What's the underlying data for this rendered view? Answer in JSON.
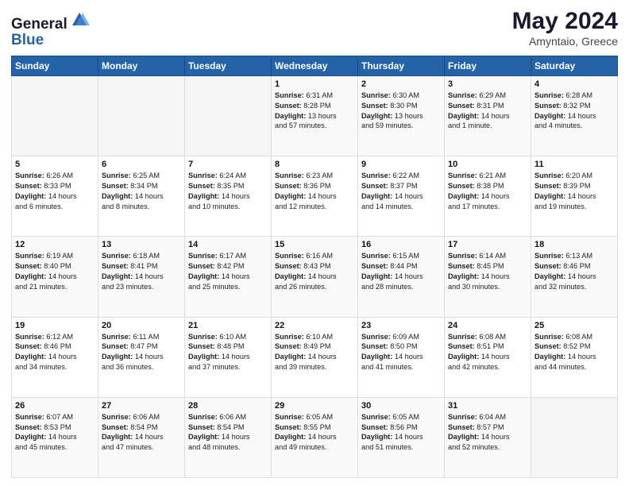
{
  "header": {
    "logo_line1": "General",
    "logo_line2": "Blue",
    "month_year": "May 2024",
    "location": "Amyntaio, Greece"
  },
  "days_of_week": [
    "Sunday",
    "Monday",
    "Tuesday",
    "Wednesday",
    "Thursday",
    "Friday",
    "Saturday"
  ],
  "weeks": [
    [
      {
        "day": "",
        "info": ""
      },
      {
        "day": "",
        "info": ""
      },
      {
        "day": "",
        "info": ""
      },
      {
        "day": "1",
        "info": "Sunrise: 6:31 AM\nSunset: 8:28 PM\nDaylight: 13 hours\nand 57 minutes."
      },
      {
        "day": "2",
        "info": "Sunrise: 6:30 AM\nSunset: 8:30 PM\nDaylight: 13 hours\nand 59 minutes."
      },
      {
        "day": "3",
        "info": "Sunrise: 6:29 AM\nSunset: 8:31 PM\nDaylight: 14 hours\nand 1 minute."
      },
      {
        "day": "4",
        "info": "Sunrise: 6:28 AM\nSunset: 8:32 PM\nDaylight: 14 hours\nand 4 minutes."
      }
    ],
    [
      {
        "day": "5",
        "info": "Sunrise: 6:26 AM\nSunset: 8:33 PM\nDaylight: 14 hours\nand 6 minutes."
      },
      {
        "day": "6",
        "info": "Sunrise: 6:25 AM\nSunset: 8:34 PM\nDaylight: 14 hours\nand 8 minutes."
      },
      {
        "day": "7",
        "info": "Sunrise: 6:24 AM\nSunset: 8:35 PM\nDaylight: 14 hours\nand 10 minutes."
      },
      {
        "day": "8",
        "info": "Sunrise: 6:23 AM\nSunset: 8:36 PM\nDaylight: 14 hours\nand 12 minutes."
      },
      {
        "day": "9",
        "info": "Sunrise: 6:22 AM\nSunset: 8:37 PM\nDaylight: 14 hours\nand 14 minutes."
      },
      {
        "day": "10",
        "info": "Sunrise: 6:21 AM\nSunset: 8:38 PM\nDaylight: 14 hours\nand 17 minutes."
      },
      {
        "day": "11",
        "info": "Sunrise: 6:20 AM\nSunset: 8:39 PM\nDaylight: 14 hours\nand 19 minutes."
      }
    ],
    [
      {
        "day": "12",
        "info": "Sunrise: 6:19 AM\nSunset: 8:40 PM\nDaylight: 14 hours\nand 21 minutes."
      },
      {
        "day": "13",
        "info": "Sunrise: 6:18 AM\nSunset: 8:41 PM\nDaylight: 14 hours\nand 23 minutes."
      },
      {
        "day": "14",
        "info": "Sunrise: 6:17 AM\nSunset: 8:42 PM\nDaylight: 14 hours\nand 25 minutes."
      },
      {
        "day": "15",
        "info": "Sunrise: 6:16 AM\nSunset: 8:43 PM\nDaylight: 14 hours\nand 26 minutes."
      },
      {
        "day": "16",
        "info": "Sunrise: 6:15 AM\nSunset: 8:44 PM\nDaylight: 14 hours\nand 28 minutes."
      },
      {
        "day": "17",
        "info": "Sunrise: 6:14 AM\nSunset: 8:45 PM\nDaylight: 14 hours\nand 30 minutes."
      },
      {
        "day": "18",
        "info": "Sunrise: 6:13 AM\nSunset: 8:46 PM\nDaylight: 14 hours\nand 32 minutes."
      }
    ],
    [
      {
        "day": "19",
        "info": "Sunrise: 6:12 AM\nSunset: 8:46 PM\nDaylight: 14 hours\nand 34 minutes."
      },
      {
        "day": "20",
        "info": "Sunrise: 6:11 AM\nSunset: 8:47 PM\nDaylight: 14 hours\nand 36 minutes."
      },
      {
        "day": "21",
        "info": "Sunrise: 6:10 AM\nSunset: 8:48 PM\nDaylight: 14 hours\nand 37 minutes."
      },
      {
        "day": "22",
        "info": "Sunrise: 6:10 AM\nSunset: 8:49 PM\nDaylight: 14 hours\nand 39 minutes."
      },
      {
        "day": "23",
        "info": "Sunrise: 6:09 AM\nSunset: 8:50 PM\nDaylight: 14 hours\nand 41 minutes."
      },
      {
        "day": "24",
        "info": "Sunrise: 6:08 AM\nSunset: 8:51 PM\nDaylight: 14 hours\nand 42 minutes."
      },
      {
        "day": "25",
        "info": "Sunrise: 6:08 AM\nSunset: 8:52 PM\nDaylight: 14 hours\nand 44 minutes."
      }
    ],
    [
      {
        "day": "26",
        "info": "Sunrise: 6:07 AM\nSunset: 8:53 PM\nDaylight: 14 hours\nand 45 minutes."
      },
      {
        "day": "27",
        "info": "Sunrise: 6:06 AM\nSunset: 8:54 PM\nDaylight: 14 hours\nand 47 minutes."
      },
      {
        "day": "28",
        "info": "Sunrise: 6:06 AM\nSunset: 8:54 PM\nDaylight: 14 hours\nand 48 minutes."
      },
      {
        "day": "29",
        "info": "Sunrise: 6:05 AM\nSunset: 8:55 PM\nDaylight: 14 hours\nand 49 minutes."
      },
      {
        "day": "30",
        "info": "Sunrise: 6:05 AM\nSunset: 8:56 PM\nDaylight: 14 hours\nand 51 minutes."
      },
      {
        "day": "31",
        "info": "Sunrise: 6:04 AM\nSunset: 8:57 PM\nDaylight: 14 hours\nand 52 minutes."
      },
      {
        "day": "",
        "info": ""
      }
    ]
  ]
}
